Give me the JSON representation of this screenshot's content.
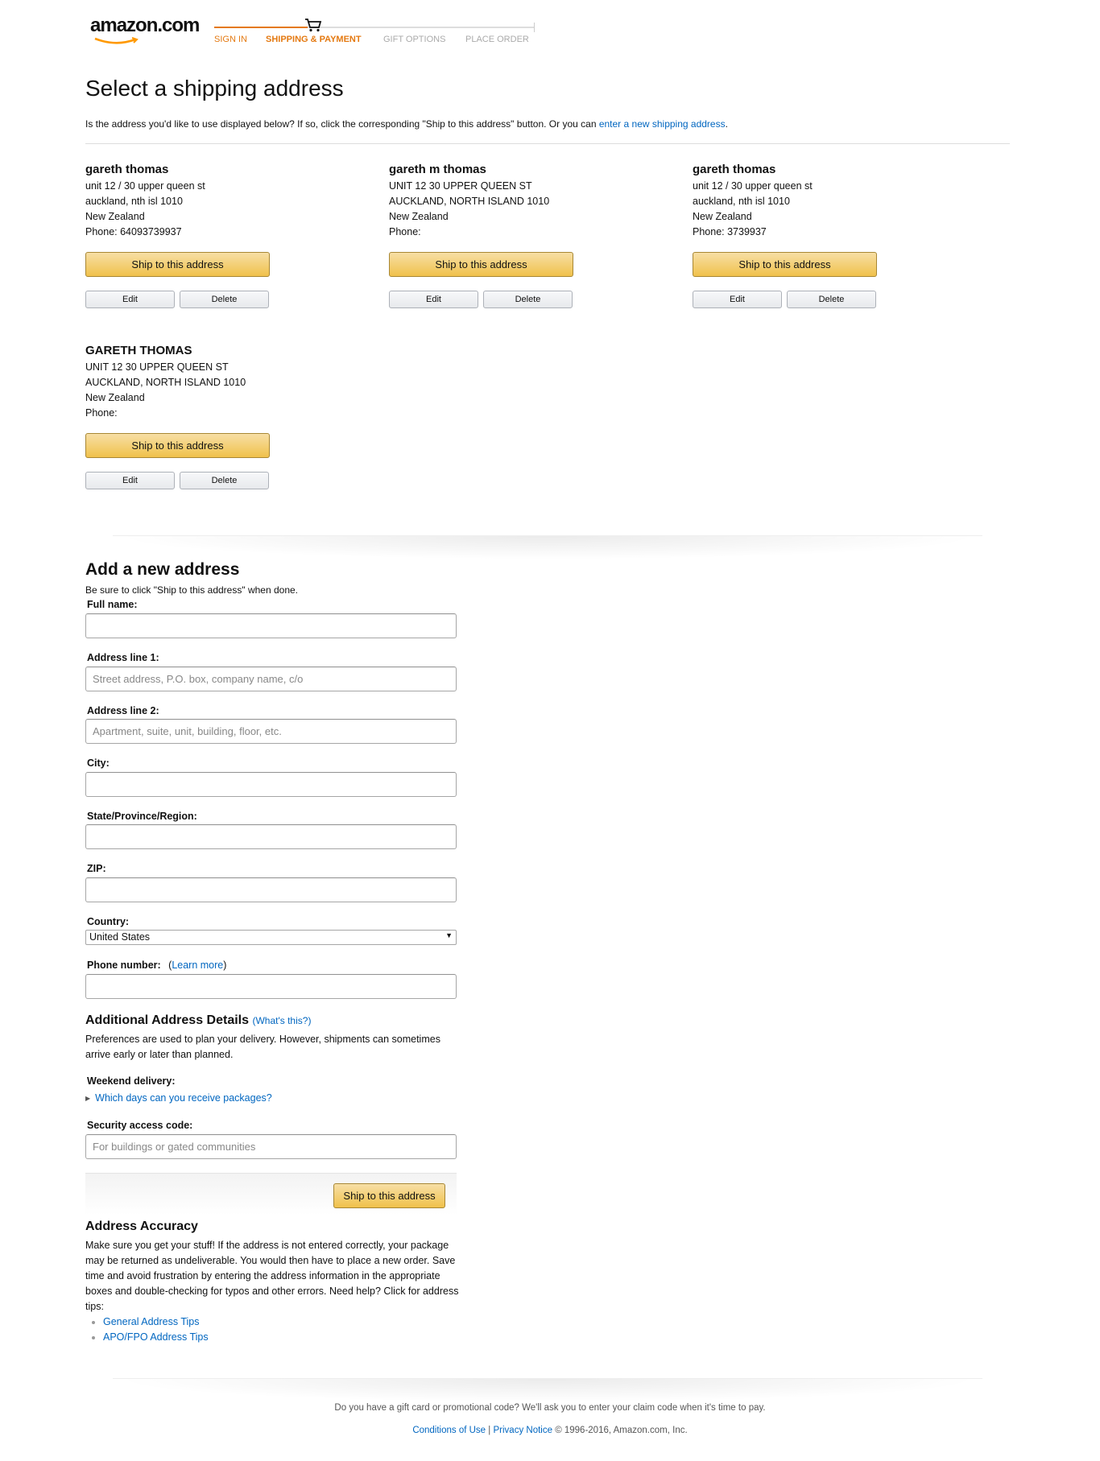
{
  "header": {
    "logo_text": "amazon.com",
    "steps": [
      "SIGN IN",
      "SHIPPING & PAYMENT",
      "GIFT OPTIONS",
      "PLACE ORDER"
    ],
    "active_step": 2
  },
  "page": {
    "title": "Select a shipping address",
    "intro_prefix": "Is the address you'd like to use displayed below? If so, click the corresponding \"Ship to this address\" button. Or you can ",
    "intro_link": "enter a new shipping address",
    "intro_suffix": "."
  },
  "addresses": [
    {
      "name": "gareth thomas",
      "line1": "unit 12 / 30 upper queen st",
      "line2": "auckland, nth isl 1010",
      "country": "New Zealand",
      "phone": "Phone: 64093739937"
    },
    {
      "name": "gareth m thomas",
      "line1": "UNIT 12 30 UPPER QUEEN ST",
      "line2": "AUCKLAND, NORTH ISLAND 1010",
      "country": "New Zealand",
      "phone": "Phone:"
    },
    {
      "name": "gareth thomas",
      "line1": "unit 12 / 30 upper queen st",
      "line2": "auckland, nth isl 1010",
      "country": "New Zealand",
      "phone": "Phone: 3739937"
    },
    {
      "name": "GARETH THOMAS",
      "line1": "UNIT 12 30 UPPER QUEEN ST",
      "line2": "AUCKLAND, NORTH ISLAND 1010",
      "country": "New Zealand",
      "phone": "Phone:"
    }
  ],
  "address_buttons": {
    "ship": "Ship to this address",
    "edit": "Edit",
    "delete": "Delete"
  },
  "new_address": {
    "title": "Add a new address",
    "subtitle": "Be sure to click \"Ship to this address\" when done.",
    "full_name_label": "Full name:",
    "full_name_value": "",
    "address1_label": "Address line 1:",
    "address1_placeholder": "Street address, P.O. box, company name, c/o",
    "address2_label": "Address line 2:",
    "address2_placeholder": "Apartment, suite, unit, building, floor, etc.",
    "city_label": "City:",
    "state_label": "State/Province/Region:",
    "zip_label": "ZIP:",
    "country_label": "Country:",
    "country_value": "United States",
    "phone_label": "Phone number:",
    "phone_learn_more": "Learn more",
    "details_title": "Additional Address Details",
    "details_whats_this": "What's this?",
    "details_text": "Preferences are used to plan your delivery. However, shipments can sometimes arrive early or later than planned.",
    "weekend_label": "Weekend delivery:",
    "weekend_link": "Which days can you receive packages?",
    "security_label": "Security access code:",
    "security_placeholder": "For buildings or gated communities",
    "submit": "Ship to this address"
  },
  "accuracy": {
    "title": "Address Accuracy",
    "text": "Make sure you get your stuff! If the address is not entered correctly, your package may be returned as undeliverable. You would then have to place a new order. Save time and avoid frustration by entering the address information in the appropriate boxes and double-checking for typos and other errors. Need help? Click for address tips:",
    "tips": [
      "General Address Tips",
      "APO/FPO Address Tips"
    ]
  },
  "footer": {
    "note": "Do you have a gift card or promotional code? We'll ask you to enter your claim code when it's time to pay.",
    "conditions": "Conditions of Use",
    "separator": "|",
    "privacy": "Privacy Notice",
    "copyright": "© 1996-2016, Amazon.com, Inc."
  },
  "colors": {
    "accent_orange": "#e47911",
    "link_blue": "#0066c0",
    "button_yellow": "#f0c14b"
  }
}
